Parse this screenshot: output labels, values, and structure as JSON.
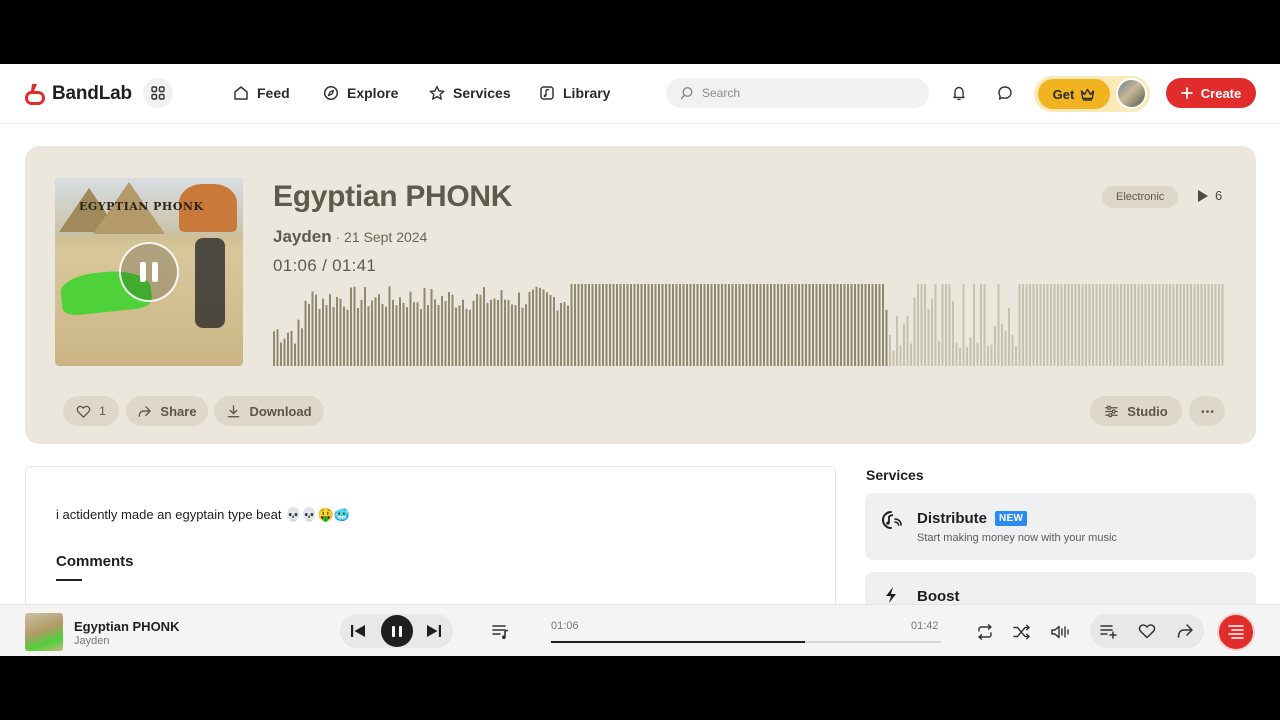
{
  "brand": {
    "name": "BandLab",
    "accent": "#e22b2b",
    "premium": "#f2b321"
  },
  "nav": {
    "items": [
      {
        "label": "Feed",
        "icon": "home-icon"
      },
      {
        "label": "Explore",
        "icon": "compass-icon"
      },
      {
        "label": "Services",
        "icon": "star-icon"
      },
      {
        "label": "Library",
        "icon": "library-icon"
      }
    ],
    "search_placeholder": "Search",
    "get_label": "Get",
    "create_label": "Create"
  },
  "track": {
    "title": "Egyptian PHONK",
    "artist": "Jayden",
    "date": "· 21 Sept 2024",
    "current_time": "01:06",
    "total_time": "01:41",
    "time_separator": "/",
    "genre": "Electronic",
    "plays": "6",
    "cover_text": "EGYPTIAN PHONK",
    "played_fraction": 0.65
  },
  "actions": {
    "likes": "1",
    "share": "Share",
    "download": "Download",
    "studio": "Studio"
  },
  "description": "i actidently made an egyptain type beat 💀💀🤑🥶",
  "comments_heading": "Comments",
  "services": {
    "heading": "Services",
    "items": [
      {
        "title": "Distribute",
        "badge": "NEW",
        "subtitle": "Start making money now with your music",
        "icon": "distribute-icon"
      },
      {
        "title": "Boost",
        "icon": "lightning-icon"
      }
    ]
  },
  "player": {
    "title": "Egyptian PHONK",
    "artist": "Jayden",
    "elapsed": "01:06",
    "duration": "01:42",
    "progress": 0.65
  }
}
